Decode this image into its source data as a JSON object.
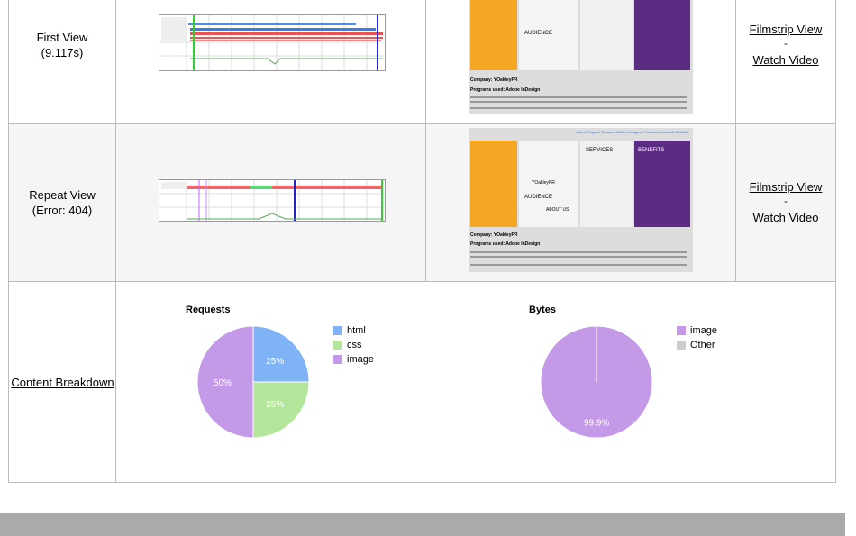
{
  "rows": [
    {
      "name": "First View",
      "detail": "(9.117s)",
      "filmstrip_label": "Filmstrip View",
      "separator": "-",
      "video_label": "Watch Video"
    },
    {
      "name": "Repeat View",
      "detail": "(Error: 404)",
      "filmstrip_label": "Filmstrip View",
      "separator": "-",
      "video_label": "Watch Video"
    }
  ],
  "screenshot": {
    "company": "Company: YOakleyPR",
    "programs": "Programs used: Adobe InDesign",
    "top_nav": "Home Projects Resume Twitter Instagram Facebook LinkedIn Dribbble",
    "panel_services": "SERVICES",
    "panel_benefits": "BENEFITS",
    "panel_brand": "YOakleyPR",
    "panel_about": "ABOUT US",
    "panel_audience": "AUDIENCE"
  },
  "content_breakdown": {
    "label": "Content Breakdown"
  },
  "chart_data": [
    {
      "type": "pie",
      "title": "Requests",
      "categories": [
        "html",
        "css",
        "image"
      ],
      "values": [
        25,
        25,
        50
      ],
      "labels": [
        "25%",
        "25%",
        "50%"
      ],
      "colors": [
        "#7fb3f5",
        "#b3e69a",
        "#c49ae8"
      ],
      "legend": "right"
    },
    {
      "type": "pie",
      "title": "Bytes",
      "categories": [
        "image",
        "Other"
      ],
      "values": [
        99.9,
        0.1
      ],
      "labels": [
        "99.9%",
        ""
      ],
      "colors": [
        "#c49ae8",
        "#cccccc"
      ],
      "legend": "right"
    }
  ]
}
